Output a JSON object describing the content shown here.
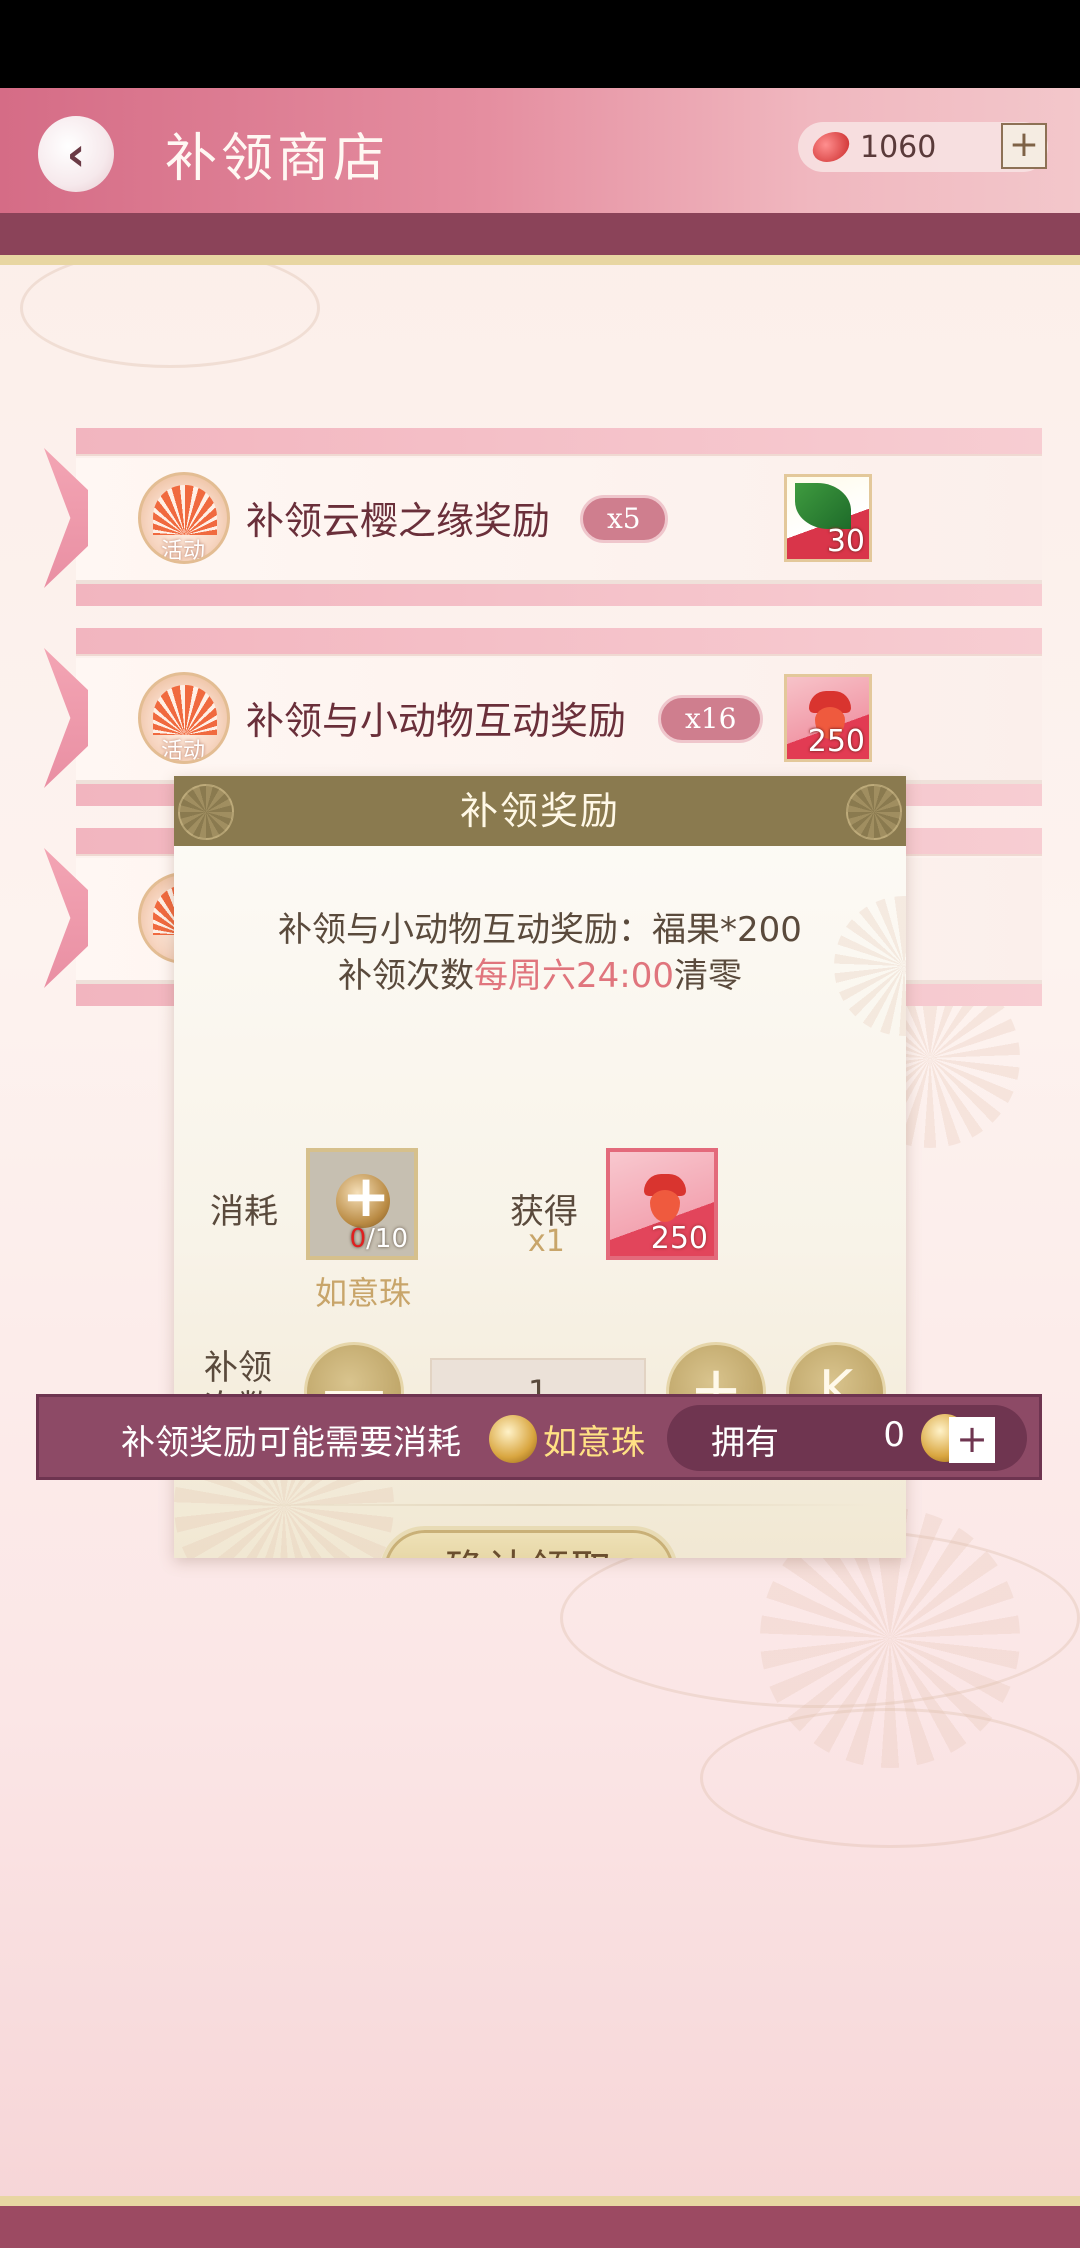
{
  "header": {
    "title": "补领商店",
    "currency_value": "1060",
    "currency_plus": "+"
  },
  "rows": [
    {
      "badge_label": "活动",
      "title": "补领云樱之缘奖励",
      "count": "x5",
      "reward_qty": "30"
    },
    {
      "badge_label": "活动",
      "title": "补领与小动物互动奖励",
      "count": "x16",
      "reward_qty": "250"
    }
  ],
  "dialog": {
    "title": "补领奖励",
    "desc_line1": "补领与小动物互动奖励：福果*200",
    "desc_line2_pre": "补领次数",
    "desc_line2_hl": "每周六24:00",
    "desc_line2_post": "清零",
    "cost_label": "消耗",
    "cost_owned": "0",
    "cost_required": "/10",
    "cost_item_name": "如意珠",
    "gain_label": "获得",
    "gain_mult": "x1",
    "gain_qty": "250",
    "times_label_1": "补领",
    "times_label_2": "次数",
    "minus": "—",
    "quantity": "1",
    "plus": "+",
    "max": "K",
    "confirm": "确认领取"
  },
  "bottom": {
    "notice": "补领奖励可能需要消耗",
    "item_name": "如意珠",
    "owned_label": "拥有",
    "owned_value": "0",
    "plus": "+"
  },
  "colors": {
    "header_pink": "#d56c86",
    "header_bar": "#8b4359",
    "dialog_head": "#8a7a4f",
    "highlight": "#e0757d",
    "gold_text": "#c8a56a"
  },
  "icons": [
    "back-arrow-icon",
    "red-bean-icon",
    "plus-icon",
    "fan-event-icon",
    "leaf-item-icon",
    "acorn-fruit-icon",
    "pearl-icon",
    "minus-icon",
    "max-icon"
  ]
}
